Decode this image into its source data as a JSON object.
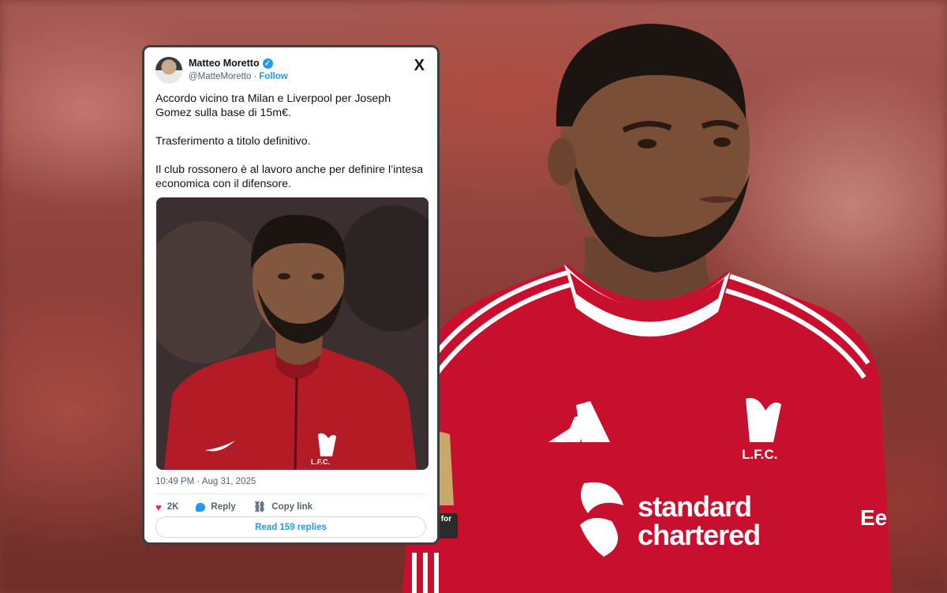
{
  "tweet": {
    "author_name": "Matteo Moretto",
    "handle": "@MatteMoretto",
    "separator": "·",
    "follow_label": "Follow",
    "platform_logo": "X",
    "paragraphs": [
      "Accordo vicino tra Milan e Liverpool per Joseph Gomez sulla base di 15m€.",
      "Trasferimento a titolo definitivo.",
      "Il club rossonero è al lavoro anche per definire l’intesa economica con il difensore."
    ],
    "timestamp": "10:49 PM · Aug 31, 2025",
    "likes_count": "2K",
    "reply_label": "Reply",
    "copy_link_label": "Copy link",
    "read_replies_label": "Read 159 replies",
    "photo_badge_text": "L.F.C."
  },
  "jersey": {
    "sponsor_line1": "standard",
    "sponsor_line2": "chartered",
    "crest_text": "L.F.C.",
    "sleeve_badge": "no room for racism",
    "sleeve_text": "Ee"
  },
  "colors": {
    "accent": "#1d9bf0",
    "like": "#f91880",
    "jersey_red": "#c8102e"
  },
  "icons": [
    "verified-icon",
    "x-logo-icon",
    "heart-icon",
    "reply-icon",
    "link-icon"
  ]
}
